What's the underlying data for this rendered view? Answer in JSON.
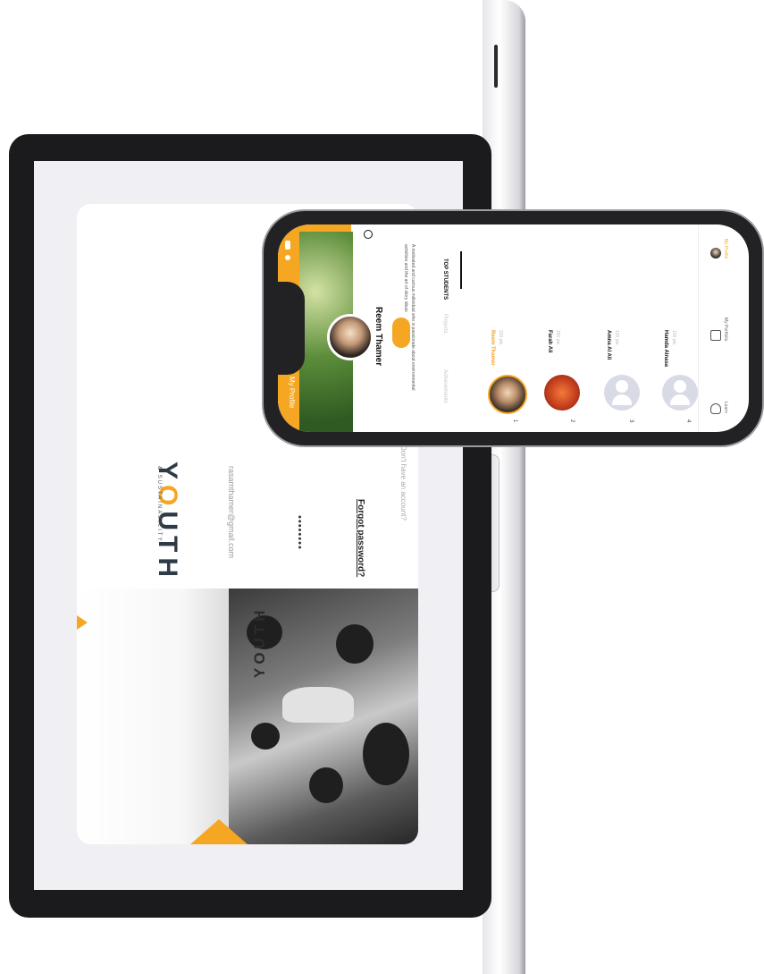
{
  "laptop": {
    "brand_prefix": "Y",
    "brand_o": "O",
    "brand_suffix": "UTH",
    "tagline": "& SUSTAINABILITY",
    "email_value": "rasamthamer@gmail.com",
    "password_value": "••••••••",
    "forgot_password": "Forgot password?",
    "signup_prompt": "Don't have an account?",
    "photo_logo": "YOUTH"
  },
  "phone": {
    "header_title": "My Profile",
    "profile_name": "Reem Thamer",
    "bio": "A motivated and curious individual who is passionate about environmental activities and the art of story ideas",
    "tabs": [
      "Achievements",
      "Projects",
      "TOP STUDENTS"
    ],
    "students": [
      {
        "rank": "1",
        "name": "Reem Thamer",
        "points": "220 pts",
        "highlight": true
      },
      {
        "rank": "2",
        "name": "Farah Ali",
        "points": "150 pts",
        "highlight": false
      },
      {
        "rank": "3",
        "name": "Amna Al Ali",
        "points": "120 pts",
        "highlight": false
      },
      {
        "rank": "4",
        "name": "Hamda Alnasa",
        "points": "100 pts",
        "highlight": false
      }
    ],
    "nav": [
      "Learn",
      "My Portfolio",
      "My Profile"
    ]
  },
  "colors": {
    "accent": "#f5a623",
    "dark": "#1b1b1d"
  }
}
